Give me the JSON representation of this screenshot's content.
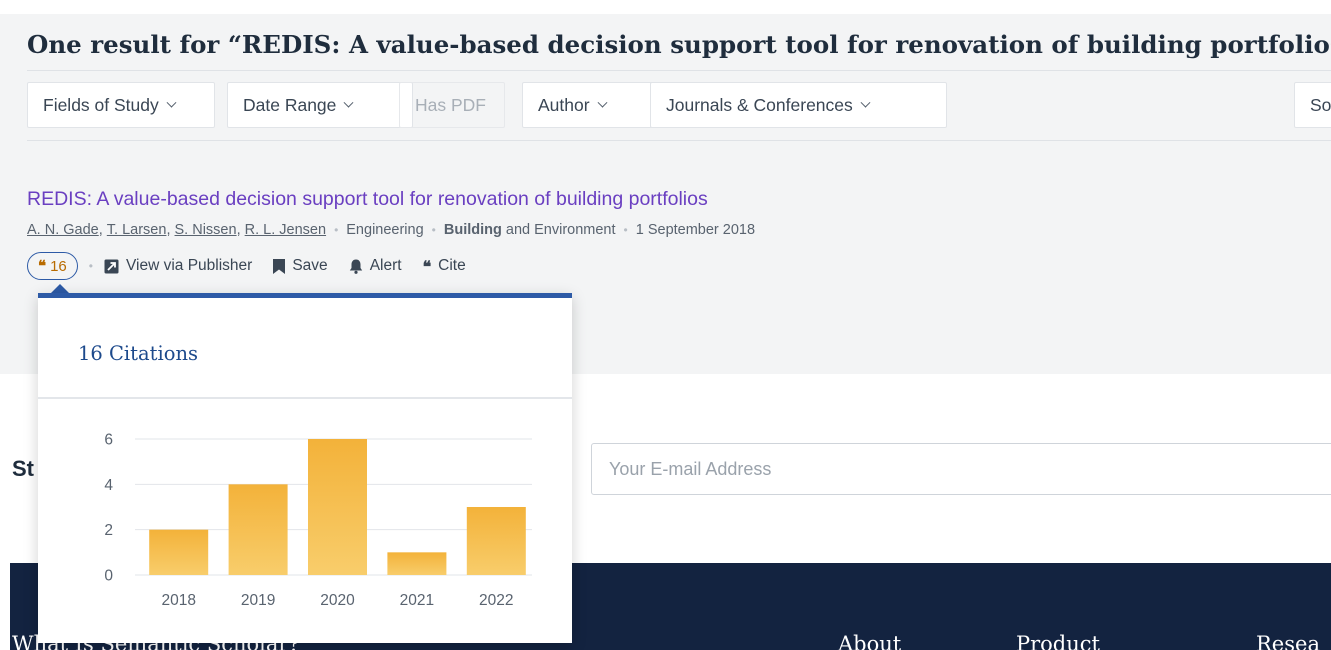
{
  "results": {
    "heading": "One result for “REDIS: A value-based decision support tool for renovation of building portfolios”",
    "filters": {
      "fields_of_study": "Fields of Study",
      "date_range": "Date Range",
      "has_pdf": "Has PDF",
      "author": "Author",
      "journals": "Journals & Conferences",
      "sort": "So"
    }
  },
  "paper": {
    "title": "REDIS: A value-based decision support tool for renovation of building portfolios",
    "authors": [
      "A. N. Gade",
      "T. Larsen",
      "S. Nissen",
      "R. L. Jensen"
    ],
    "field": "Engineering",
    "venue_bold": "Building",
    "venue_rest": "and Environment",
    "date": "1 September 2018",
    "citation_count": "16",
    "actions": {
      "view": "View via Publisher",
      "save": "Save",
      "alert": "Alert",
      "cite": "Cite"
    }
  },
  "popover": {
    "title": "16 Citations"
  },
  "chart_data": {
    "type": "bar",
    "categories": [
      "2018",
      "2019",
      "2020",
      "2021",
      "2022"
    ],
    "values": [
      2,
      4,
      6,
      1,
      3
    ],
    "ylim": [
      0,
      6
    ],
    "yticks": [
      0,
      2,
      4,
      6
    ],
    "grid": true,
    "bar_color_top": "#f3b23a",
    "bar_color_bottom": "#f8cd6b"
  },
  "newsletter": {
    "text": "St",
    "email_placeholder": "Your E-mail Address"
  },
  "footer": {
    "what": "What Is Semantic Scholar?",
    "about": "About",
    "product": "Product",
    "research": "Resea"
  },
  "colors": {
    "accent": "#2d5aa6",
    "title_link": "#6a3fc1",
    "footer_bg": "#132340",
    "citation_orange": "#b86b00"
  }
}
